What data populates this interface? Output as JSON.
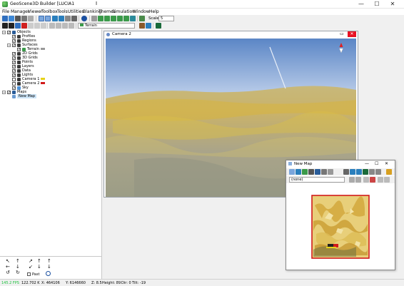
{
  "window": {
    "title": "GeoScene3D Builder [LUCIA1",
    "minimize_glyph": "—",
    "maximize_glyph": "☐",
    "close_glyph": "✕",
    "cursor_glyph": "I"
  },
  "menu": [
    "File",
    "Manager",
    "Viewer",
    "Toolbox",
    "Tools",
    "Utilities",
    "Blanking",
    "Themes",
    "Simulation",
    "Window",
    "Help"
  ],
  "toolbar": {
    "scale_label": "Scale:",
    "scale_value": "5",
    "terrain_value": "Terrain"
  },
  "tree": {
    "expander_open": "−",
    "check_glyph": "✓",
    "nodes": [
      {
        "label": "Objects",
        "checked": true,
        "icon": "objects-icon"
      },
      {
        "label": "Profiles",
        "checked": true,
        "icon": "profiles-icon"
      },
      {
        "label": "Regions",
        "checked": true,
        "icon": "regions-icon"
      },
      {
        "label": "Surfaces",
        "checked": true,
        "icon": "surfaces-icon"
      },
      {
        "label": "Terrain",
        "checked": true,
        "icon": "terrain-icon"
      },
      {
        "label": "2D Grids",
        "checked": true,
        "icon": "grid2d-icon"
      },
      {
        "label": "3D Grids",
        "checked": true,
        "icon": "grid3d-icon"
      },
      {
        "label": "Points",
        "checked": true,
        "icon": "points-icon"
      },
      {
        "label": "Layers",
        "checked": true,
        "icon": "layers-icon"
      },
      {
        "label": "Data",
        "checked": true,
        "icon": "data-icon"
      },
      {
        "label": "Lights",
        "checked": true,
        "icon": "lights-icon"
      },
      {
        "label": "Camera 1",
        "checked": false,
        "icon": "camera-icon"
      },
      {
        "label": "Camera 2",
        "checked": false,
        "icon": "camera-icon"
      },
      {
        "label": "Sky",
        "checked": true,
        "icon": "sky-icon"
      },
      {
        "label": "Maps",
        "checked": true,
        "icon": "maps-icon"
      },
      {
        "label": "New Map",
        "checked": false,
        "icon": "map-icon"
      }
    ]
  },
  "navpad": {
    "past_label": "Past",
    "arrow_glyphs": [
      "↖",
      "↑",
      "↗",
      "↑",
      "↑",
      "←",
      "•",
      "→",
      "↓",
      "↓",
      "↙",
      "↓",
      "↘",
      "↺",
      "↻"
    ]
  },
  "camera_window": {
    "title": "Camera 2",
    "max_glyph": "▭",
    "close_glyph": "✕"
  },
  "map_window": {
    "title": "New Map",
    "layer_value": "(none)",
    "minimize_glyph": "—",
    "maximize_glyph": "☐",
    "close_glyph": "✕"
  },
  "statusbar": {
    "fps": "145.2 FPS",
    "zoom": "122.702 K",
    "x": "X: 464106",
    "y": "Y: 6146660",
    "z": "Z: 8.5",
    "height": "Height: 89",
    "dir": "Dir: 0",
    "tilt": "Tilt: -19"
  },
  "colors": {
    "fps_green": "#19c23b",
    "sky_top": "#5b86c6",
    "sky_bottom": "#c8d7ee",
    "terrain_yellow": "#d7b43e",
    "map_border": "#d11a1a",
    "north_red": "#e02020"
  }
}
